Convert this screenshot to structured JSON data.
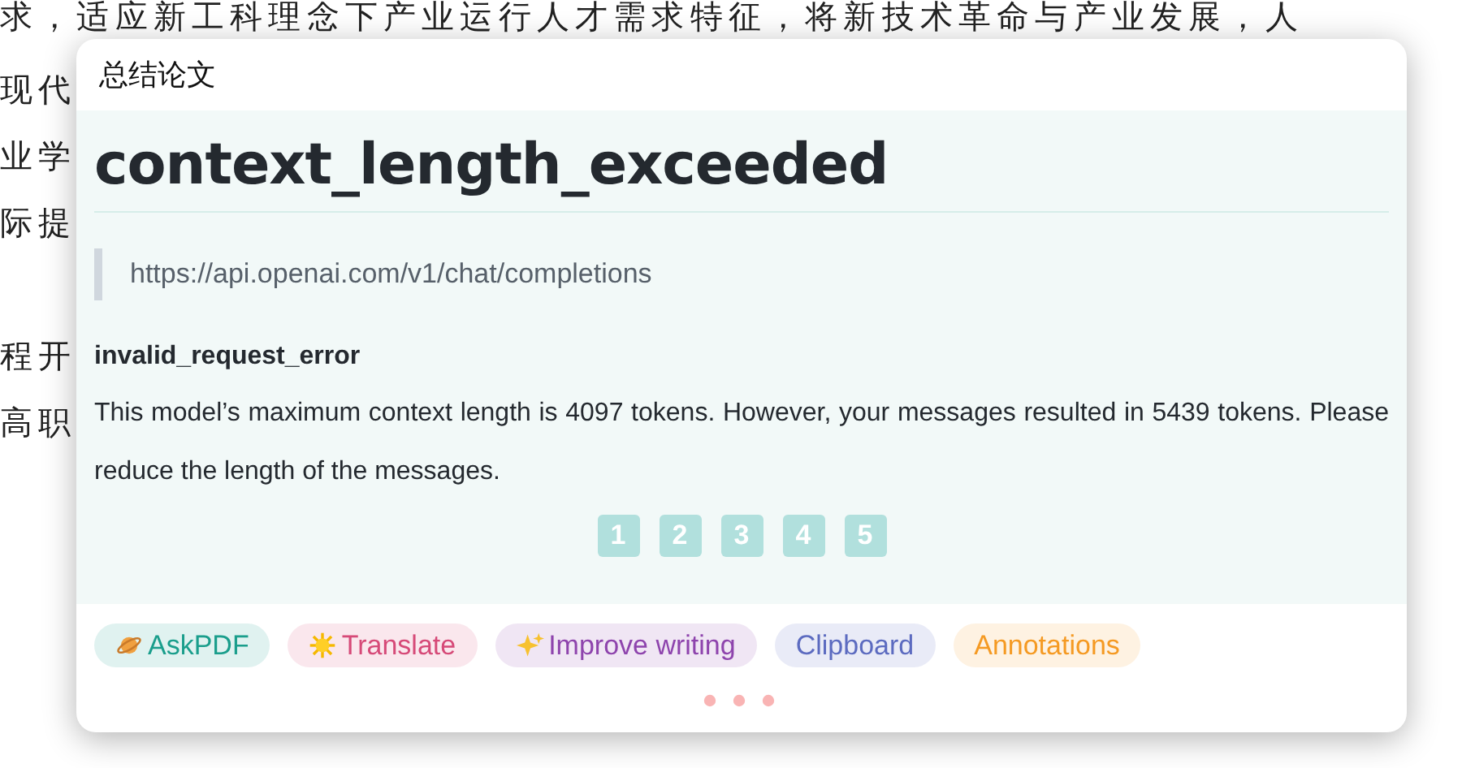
{
  "document": {
    "paragraphs": [
      {
        "lines": [
          "求，适应新工科理念下产业运行人才需求特征，将新技术革命与产业发展，人",
          "现代",
          "业学",
          "际提"
        ]
      },
      {
        "lines": [
          "程开",
          "高职"
        ]
      }
    ]
  },
  "popup": {
    "title": "总结论文",
    "error": {
      "heading": "context_length_exceeded",
      "url": "https://api.openai.com/v1/chat/completions",
      "type": "invalid_request_error",
      "message": "This model’s maximum context length is 4097 tokens. However, your messages resulted in 5439 tokens. Please reduce the length of the messages."
    },
    "pages": [
      {
        "label": "1",
        "selected": false
      },
      {
        "label": "2",
        "selected": false
      },
      {
        "label": "3",
        "selected": false
      },
      {
        "label": "4",
        "selected": false
      },
      {
        "label": "5",
        "selected": false
      }
    ],
    "actions": [
      {
        "label": "AskPDF",
        "kind": "planet",
        "color": "#1a9e8c"
      },
      {
        "label": "Translate",
        "kind": "sun",
        "color": "#d64a78"
      },
      {
        "label": "Improve writing",
        "kind": "sparkles",
        "color": "#8e44ad"
      },
      {
        "label": "Clipboard",
        "kind": "plain",
        "color": "#5c6bc0"
      },
      {
        "label": "Annotations",
        "kind": "plain",
        "color": "#f59a23"
      }
    ]
  }
}
